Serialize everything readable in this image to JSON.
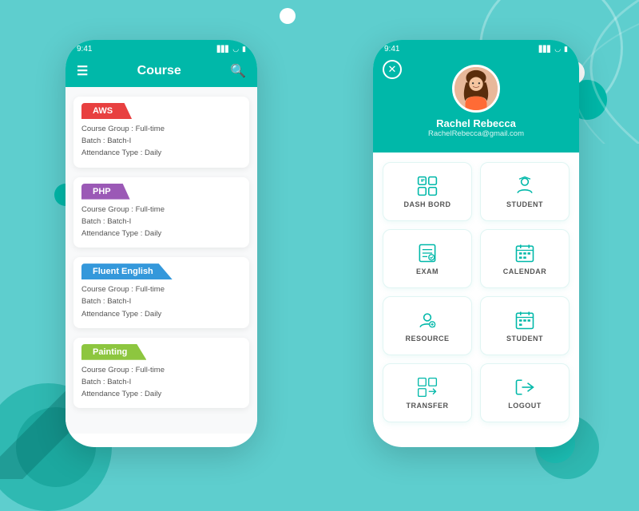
{
  "background_color": "#5ecece",
  "left_phone": {
    "status_bar": {
      "time": "9:41",
      "signal": "▋▋▋",
      "wifi": "wifi",
      "battery": "battery"
    },
    "header": {
      "title": "Course",
      "menu_label": "☰",
      "search_label": "🔍"
    },
    "courses": [
      {
        "name": "AWS",
        "tag_color": "#e84040",
        "course_group": "Course Group : Full-time",
        "batch": "Batch : Batch-I",
        "attendance": "Attendance Type : Daily"
      },
      {
        "name": "PHP",
        "tag_color": "#9b59b6",
        "course_group": "Course Group : Full-time",
        "batch": "Batch : Batch-I",
        "attendance": "Attendance Type : Daily"
      },
      {
        "name": "Fluent English",
        "tag_color": "#3498db",
        "course_group": "Course Group : Full-time",
        "batch": "Batch : Batch-I",
        "attendance": "Attendance Type : Daily"
      },
      {
        "name": "Painting",
        "tag_color": "#8dc63f",
        "course_group": "Course Group : Full-time",
        "batch": "Batch : Batch-I",
        "attendance": "Attendance Type : Daily"
      }
    ]
  },
  "right_phone": {
    "status_bar": {
      "time": "9:41"
    },
    "user": {
      "name": "Rachel Rebecca",
      "email": "RachelRebecca@gmail.com"
    },
    "menu_items": [
      {
        "id": "dash-bord",
        "label": "DASH BORD",
        "icon": "dashboard"
      },
      {
        "id": "student",
        "label": "STUDENT",
        "icon": "student"
      },
      {
        "id": "exam",
        "label": "EXAM",
        "icon": "exam"
      },
      {
        "id": "calendar",
        "label": "CALENDAR",
        "icon": "calendar"
      },
      {
        "id": "resource",
        "label": "RESOURCE",
        "icon": "resource"
      },
      {
        "id": "student2",
        "label": "STUDENT",
        "icon": "student2"
      },
      {
        "id": "transfer",
        "label": "TRANSFER",
        "icon": "transfer"
      },
      {
        "id": "logout",
        "label": "LOGOUT",
        "icon": "logout"
      }
    ]
  },
  "decorative": {
    "circles": []
  }
}
